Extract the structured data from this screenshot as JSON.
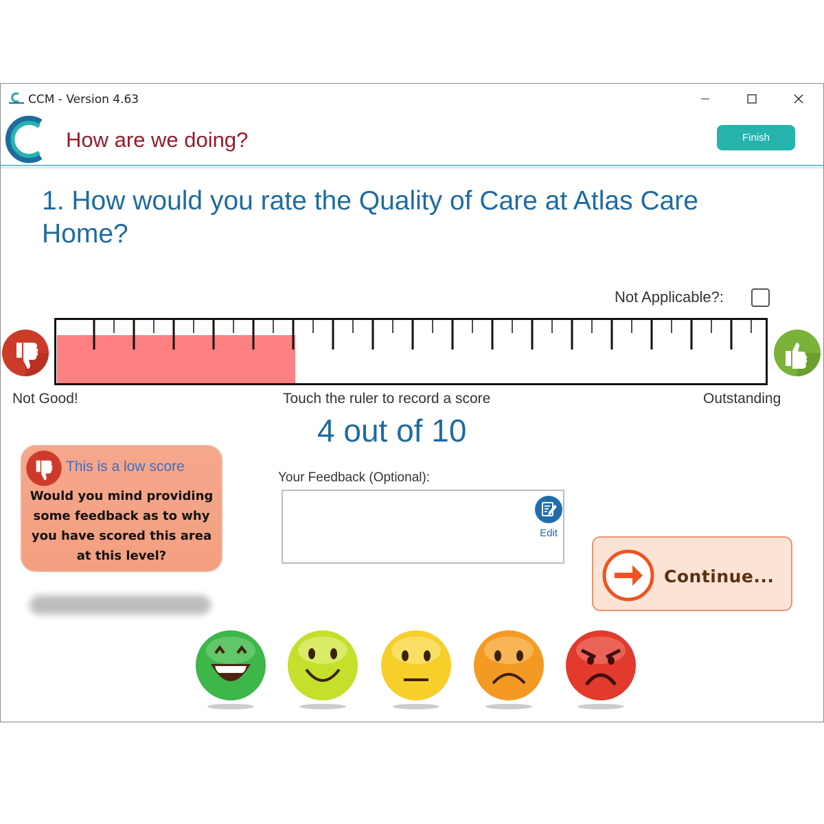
{
  "window": {
    "title": "CCM - Version 4.63"
  },
  "header": {
    "title": "How are we doing?",
    "finish_label": "Finish"
  },
  "question": {
    "text": "1. How would you rate the Quality of Care at Atlas Care Home?"
  },
  "not_applicable": {
    "label": "Not Applicable?:",
    "checked": false
  },
  "ruler": {
    "min": 0,
    "max": 10,
    "value": 4,
    "fill_color": "#ff8080",
    "low_label": "Not Good!",
    "hint": "Touch the ruler to record a score",
    "high_label": "Outstanding"
  },
  "score_text": "4 out of 10",
  "low_score_panel": {
    "title": "This is a low score",
    "message": "Would you mind providing some feedback as to why you have scored this area at this level?"
  },
  "feedback": {
    "label": "Your Feedback (Optional):",
    "value": "",
    "edit_label": "Edit"
  },
  "continue": {
    "label": "Continue..."
  },
  "faces": [
    {
      "name": "laughing-face-icon",
      "color": "#3db64a"
    },
    {
      "name": "smiling-face-icon",
      "color": "#c5df2a"
    },
    {
      "name": "neutral-face-icon",
      "color": "#f7cf2a"
    },
    {
      "name": "sad-face-icon",
      "color": "#f49a23"
    },
    {
      "name": "angry-face-icon",
      "color": "#e23a2c"
    }
  ],
  "colors": {
    "accent_teal": "#26b2ad",
    "title_red": "#951c2a",
    "question_blue": "#1e6ba1"
  }
}
